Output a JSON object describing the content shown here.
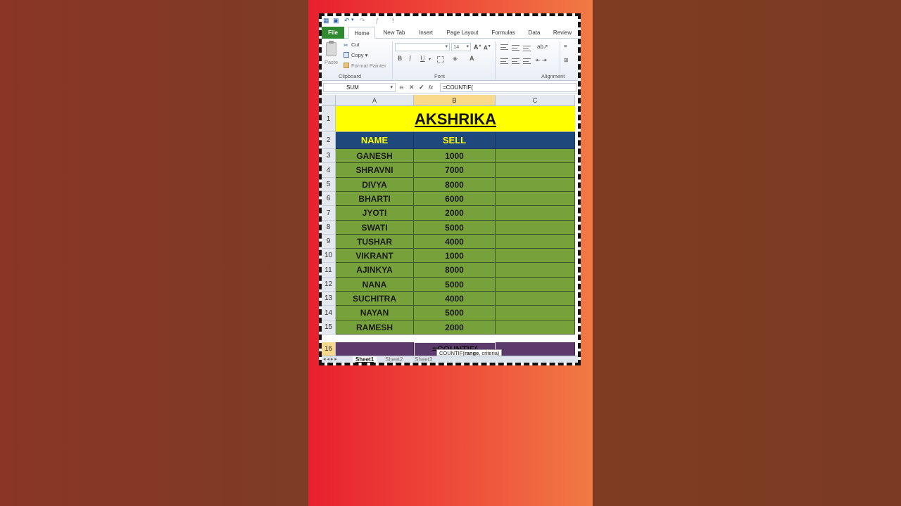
{
  "ribbon": {
    "tabs": [
      "File",
      "Home",
      "New Tab",
      "Insert",
      "Page Layout",
      "Formulas",
      "Data",
      "Review"
    ],
    "active_tab": "Home",
    "clipboard": {
      "paste": "Paste",
      "cut": "Cut",
      "copy": "Copy",
      "format_painter": "Format Painter",
      "group_label": "Clipboard"
    },
    "font": {
      "size": "14",
      "bold": "B",
      "italic": "I",
      "underline": "U",
      "group_label": "Font"
    },
    "alignment": {
      "group_label": "Alignment"
    }
  },
  "formula_bar": {
    "name_box": "SUM",
    "fx": "fx",
    "formula": "=COUNTIF("
  },
  "sheet": {
    "columns": [
      "A",
      "B",
      "C"
    ],
    "title": "AKSHRIKA",
    "headers": [
      "NAME",
      "SELL"
    ],
    "rows": [
      {
        "n": "3",
        "name": "GANESH",
        "sell": "1000"
      },
      {
        "n": "4",
        "name": "SHRAVNI",
        "sell": "7000"
      },
      {
        "n": "5",
        "name": "DIVYA",
        "sell": "8000"
      },
      {
        "n": "6",
        "name": "BHARTI",
        "sell": "6000"
      },
      {
        "n": "7",
        "name": "JYOTI",
        "sell": "2000"
      },
      {
        "n": "8",
        "name": "SWATI",
        "sell": "5000"
      },
      {
        "n": "9",
        "name": "TUSHAR",
        "sell": "4000"
      },
      {
        "n": "10",
        "name": "VIKRANT",
        "sell": "1000"
      },
      {
        "n": "11",
        "name": "AJINKYA",
        "sell": "8000"
      },
      {
        "n": "12",
        "name": "NANA",
        "sell": "5000"
      },
      {
        "n": "13",
        "name": "SUCHITRA",
        "sell": "4000"
      },
      {
        "n": "14",
        "name": "NAYAN",
        "sell": "5000"
      },
      {
        "n": "15",
        "name": "RAMESH",
        "sell": "2000"
      }
    ],
    "row_labels": {
      "r1": "1",
      "r2": "2",
      "r16": "16"
    },
    "editing_cell": "=COUNTIF(",
    "tooltip_fn": "COUNTIF(",
    "tooltip_arg1": "range",
    "tooltip_rest": ", criteria)"
  },
  "sheet_tabs": [
    "Sheet1",
    "Sheet2",
    "Sheet3"
  ],
  "colors": {
    "title_fill": "#ffff00",
    "header_fill": "#1f497d",
    "header_text": "#ffff00",
    "data_fill": "#77a13a",
    "edit_row_fill": "#5c3a6b"
  }
}
